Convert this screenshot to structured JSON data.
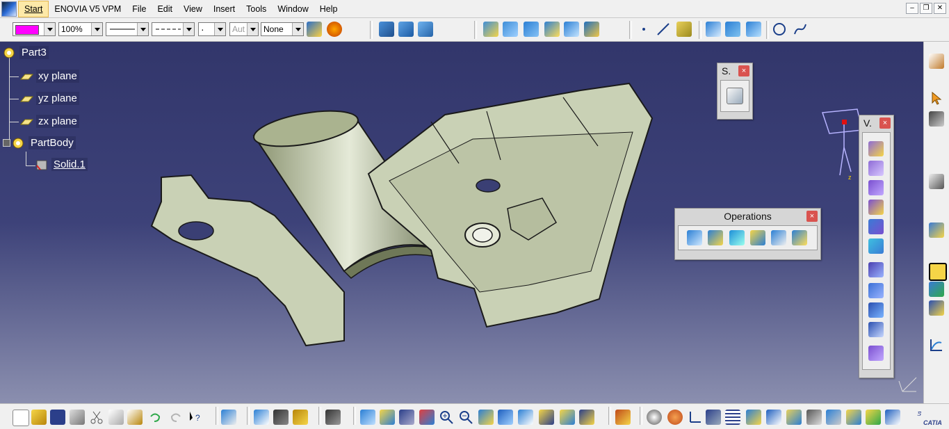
{
  "menubar": {
    "items": [
      "Start",
      "ENOVIA V5 VPM",
      "File",
      "Edit",
      "View",
      "Insert",
      "Tools",
      "Window",
      "Help"
    ]
  },
  "toolbar_top": {
    "zoom_value": "100%",
    "line_type_value": "Aut",
    "layer_value": "None",
    "color_value": "#ff00ff"
  },
  "tree": {
    "root": "Part3",
    "planes": [
      "xy plane",
      "yz plane",
      "zx plane"
    ],
    "body": "PartBody",
    "solid": "Solid.1"
  },
  "panels": {
    "sketcher_title": "S.",
    "operations_title": "Operations",
    "volumes_title": "V.",
    "close_glyph": "×"
  },
  "compass": {
    "axis_label": "z"
  },
  "brand": {
    "name": "CATIA"
  },
  "colors": {
    "viewport_top": "#32366b",
    "part_fill": "#c9d1b5",
    "accent": "#ff00ff"
  }
}
